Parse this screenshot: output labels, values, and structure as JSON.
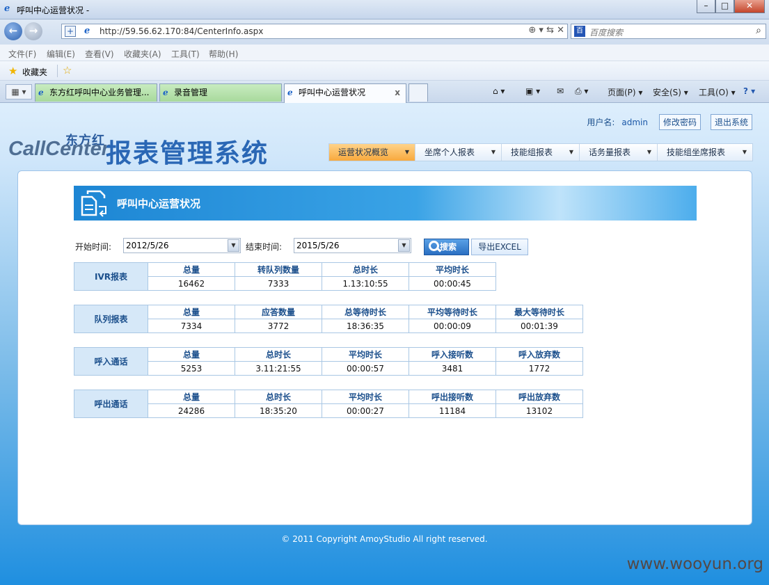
{
  "browser": {
    "window_title": "呼叫中心运营状况 -",
    "url": "http://59.56.62.170:84/CenterInfo.aspx",
    "search_placeholder": "百度搜索",
    "menu": [
      "文件(F)",
      "编辑(E)",
      "查看(V)",
      "收藏夹(A)",
      "工具(T)",
      "帮助(H)"
    ],
    "favorites_label": "收藏夹",
    "tabs": [
      {
        "label": "东方红呼叫中心业务管理..."
      },
      {
        "label": "录音管理"
      },
      {
        "label": "呼叫中心运营状况"
      }
    ],
    "commands": {
      "page": "页面(P)",
      "safety": "安全(S)",
      "tools": "工具(O)"
    }
  },
  "header": {
    "brand_small": "东方红",
    "brand_cc": "CallCenter",
    "brand_title": "报表管理系统",
    "user_label": "用户名:",
    "username": "admin",
    "change_password": "修改密码",
    "logout": "退出系统"
  },
  "nav": [
    {
      "label": "运营状况概览",
      "active": true
    },
    {
      "label": "坐席个人报表"
    },
    {
      "label": "技能组报表"
    },
    {
      "label": "话务量报表"
    },
    {
      "label": "技能组坐席报表"
    }
  ],
  "panel": {
    "title": "呼叫中心运营状况",
    "start_label": "开始时间:",
    "start_value": "2012/5/26",
    "end_label": "结束时间:",
    "end_value": "2015/5/26",
    "search_button": "搜索",
    "export_button": "导出EXCEL"
  },
  "reports": [
    {
      "title": "IVR报表",
      "headers": [
        "总量",
        "转队列数量",
        "总时长",
        "平均时长"
      ],
      "values": [
        "16462",
        "7333",
        "1.13:10:55",
        "00:00:45"
      ]
    },
    {
      "title": "队列报表",
      "headers": [
        "总量",
        "应答数量",
        "总等待时长",
        "平均等待时长",
        "最大等待时长"
      ],
      "values": [
        "7334",
        "3772",
        "18:36:35",
        "00:00:09",
        "00:01:39"
      ]
    },
    {
      "title": "呼入通话",
      "headers": [
        "总量",
        "总时长",
        "平均时长",
        "呼入接听数",
        "呼入放弃数"
      ],
      "values": [
        "5253",
        "3.11:21:55",
        "00:00:57",
        "3481",
        "1772"
      ]
    },
    {
      "title": "呼出通话",
      "headers": [
        "总量",
        "总时长",
        "平均时长",
        "呼出接听数",
        "呼出放弃数"
      ],
      "values": [
        "24286",
        "18:35:20",
        "00:00:27",
        "11184",
        "13102"
      ]
    }
  ],
  "footer": "© 2011 Copyright AmoyStudio All right reserved.",
  "watermark": "www.wooyun.org"
}
